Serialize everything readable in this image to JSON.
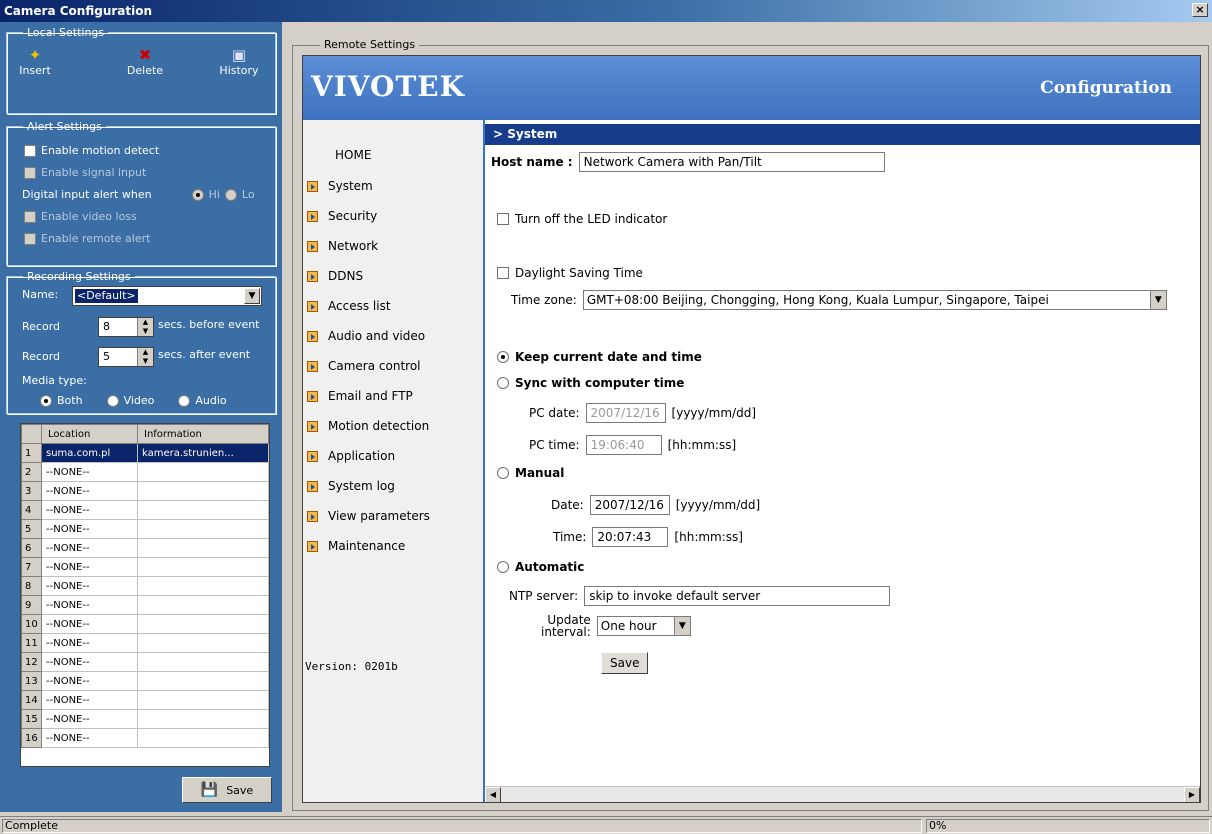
{
  "window": {
    "title": "Camera Configuration",
    "close": "×"
  },
  "local": {
    "legend": "Local Settings",
    "insert": "Insert",
    "delete": "Delete",
    "history": "History"
  },
  "alert": {
    "legend": "Alert Settings",
    "motion": "Enable motion detect",
    "signal": "Enable signal input",
    "digital": "Digital input alert when",
    "hi": "Hi",
    "lo": "Lo",
    "videoloss": "Enable video loss",
    "remote": "Enable remote alert"
  },
  "recording": {
    "legend": "Recording Settings",
    "name_label": "Name:",
    "name_value": "<Default>",
    "before_label": "Record",
    "before_value": "8",
    "before_suffix": "secs. before event",
    "after_label": "Record",
    "after_value": "5",
    "after_suffix": "secs. after event",
    "media_label": "Media type:",
    "both": "Both",
    "video": "Video",
    "audio": "Audio"
  },
  "grid": {
    "col_location": "Location",
    "col_information": "Information",
    "rows": [
      {
        "n": "1",
        "loc": "suma.com.pl",
        "info": "kamera.strunien..."
      },
      {
        "n": "2",
        "loc": "--NONE--",
        "info": ""
      },
      {
        "n": "3",
        "loc": "--NONE--",
        "info": ""
      },
      {
        "n": "4",
        "loc": "--NONE--",
        "info": ""
      },
      {
        "n": "5",
        "loc": "--NONE--",
        "info": ""
      },
      {
        "n": "6",
        "loc": "--NONE--",
        "info": ""
      },
      {
        "n": "7",
        "loc": "--NONE--",
        "info": ""
      },
      {
        "n": "8",
        "loc": "--NONE--",
        "info": ""
      },
      {
        "n": "9",
        "loc": "--NONE--",
        "info": ""
      },
      {
        "n": "10",
        "loc": "--NONE--",
        "info": ""
      },
      {
        "n": "11",
        "loc": "--NONE--",
        "info": ""
      },
      {
        "n": "12",
        "loc": "--NONE--",
        "info": ""
      },
      {
        "n": "13",
        "loc": "--NONE--",
        "info": ""
      },
      {
        "n": "14",
        "loc": "--NONE--",
        "info": ""
      },
      {
        "n": "15",
        "loc": "--NONE--",
        "info": ""
      },
      {
        "n": "16",
        "loc": "--NONE--",
        "info": ""
      }
    ],
    "save": "Save"
  },
  "remote": {
    "legend": "Remote Settings",
    "logo": "VIVOTEK",
    "banner_title": "Configuration",
    "nav": {
      "home": "HOME",
      "items": [
        "System",
        "Security",
        "Network",
        "DDNS",
        "Access list",
        "Audio and video",
        "Camera control",
        "Email and FTP",
        "Motion detection",
        "Application",
        "System log",
        "View parameters",
        "Maintenance"
      ],
      "version": "Version: 0201b"
    },
    "section": "> System",
    "hostname_label": "Host name :",
    "hostname_value": "Network Camera with Pan/Tilt",
    "led": "Turn off the LED indicator",
    "dst": "Daylight Saving Time",
    "tz_label": "Time zone:",
    "tz_value": "GMT+08:00 Beijing, Chongging, Hong Kong, Kuala Lumpur, Singapore, Taipei",
    "keep": "Keep current date and time",
    "sync": "Sync with computer time",
    "pcdate_label": "PC date:",
    "pcdate_value": "2007/12/16",
    "pcdate_fmt": "[yyyy/mm/dd]",
    "pctime_label": "PC time:",
    "pctime_value": "19:06:40",
    "pctime_fmt": "[hh:mm:ss]",
    "manual": "Manual",
    "date_label": "Date:",
    "date_value": "2007/12/16",
    "date_fmt": "[yyyy/mm/dd]",
    "time_label": "Time:",
    "time_value": "20:07:43",
    "time_fmt": "[hh:mm:ss]",
    "automatic": "Automatic",
    "ntp_label": "NTP server:",
    "ntp_value": "skip to invoke default server",
    "update_label1": "Update",
    "update_label2": "interval:",
    "update_value": "One hour",
    "save": "Save"
  },
  "status": {
    "left": "Complete",
    "right": "0%"
  }
}
